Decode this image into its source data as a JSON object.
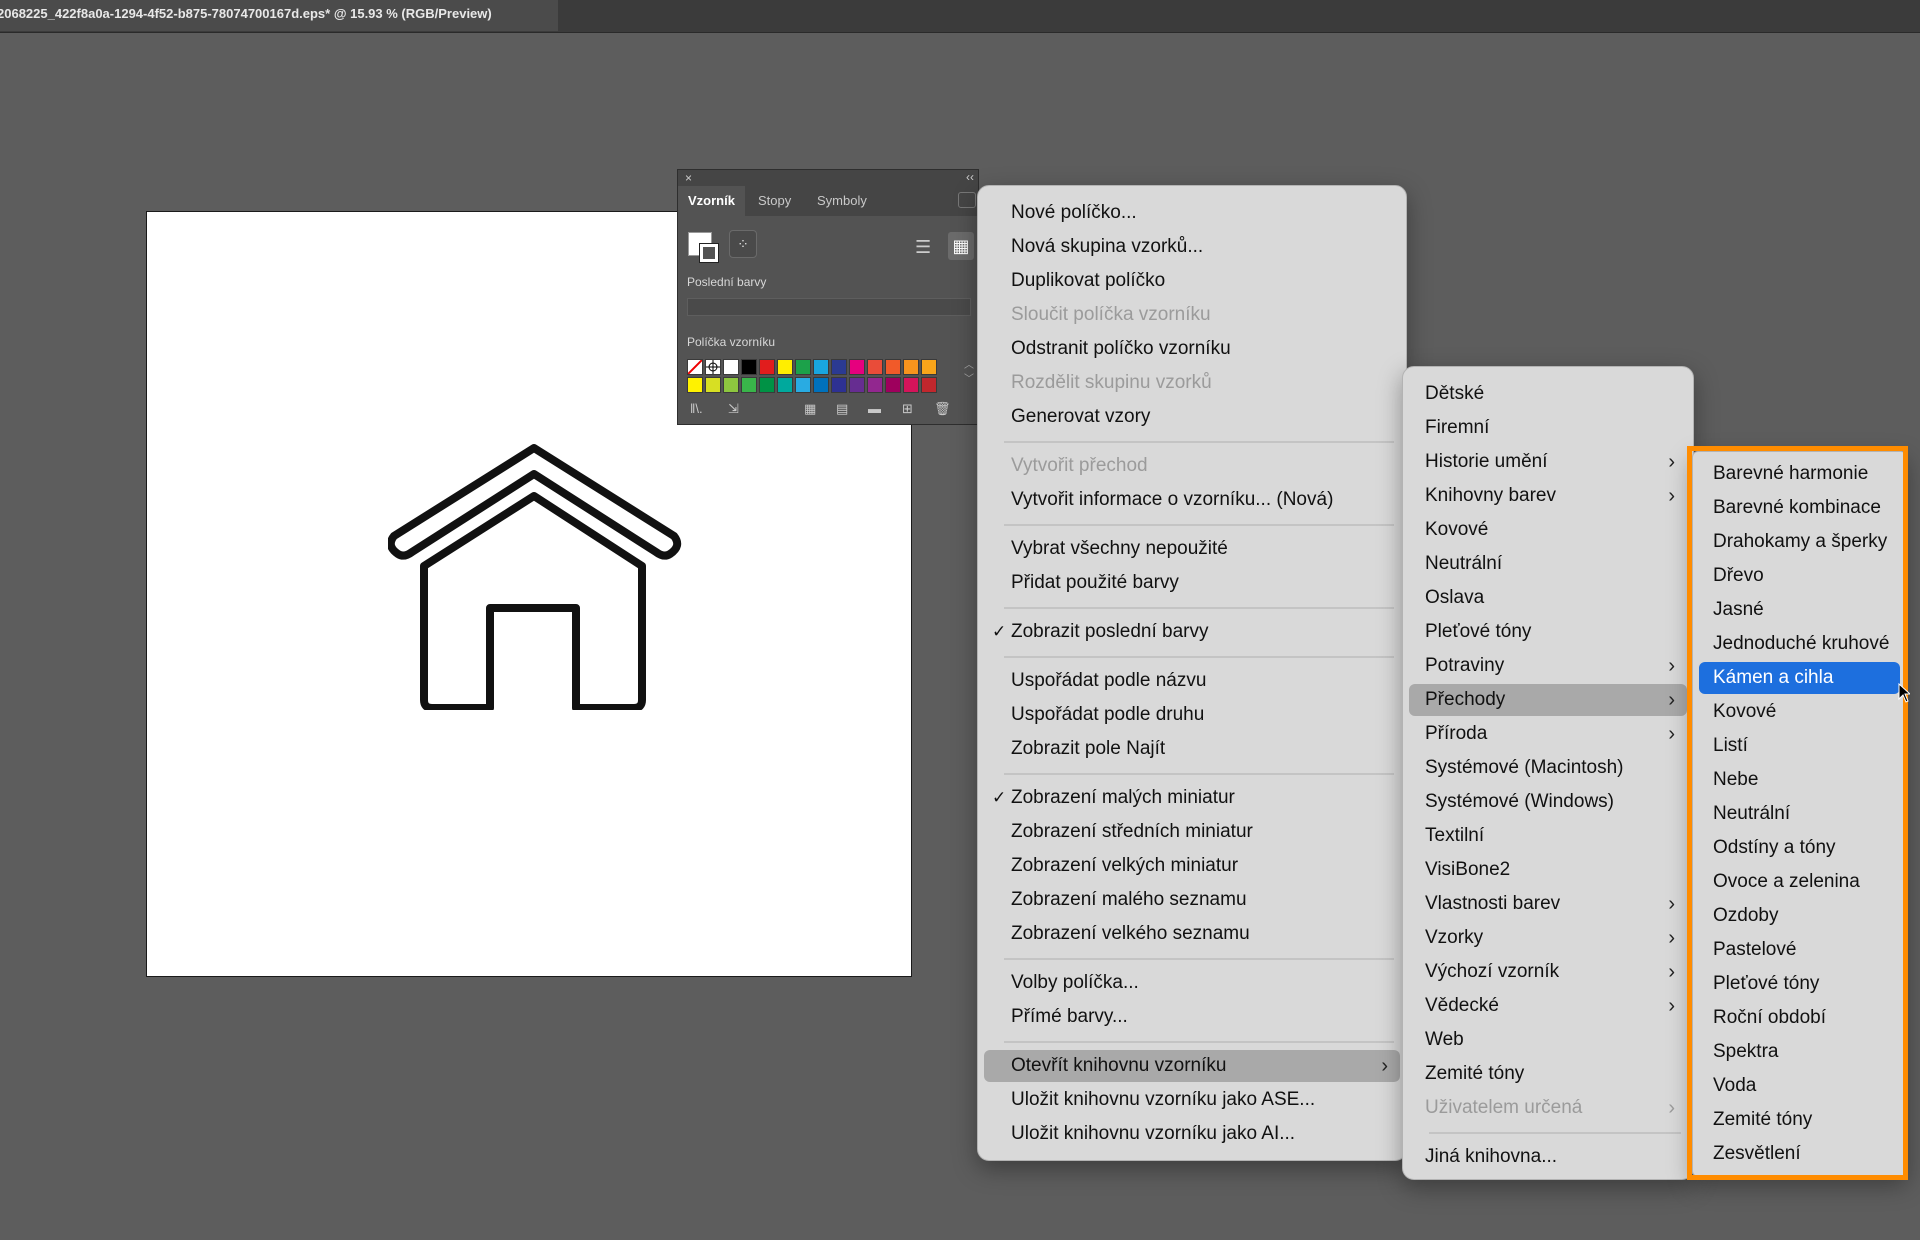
{
  "document_tab": {
    "title": "2068225_422f8a0a-1294-4f52-b875-78074700167d.eps* @ 15.93 % (RGB/Preview)"
  },
  "swatches_panel": {
    "tabs": [
      "Vzorník",
      "Stopy",
      "Symboly"
    ],
    "active_tab": "Vzorník",
    "recent_colors_label": "Poslední barvy",
    "swatches_label": "Políčka vzorníku",
    "row1_colors": [
      "#ffffff",
      "#ffffff",
      "#ffffff",
      "#000000",
      "#e11d1d",
      "#ffee00",
      "#1ca14a",
      "#19a6e0",
      "#2b3a92",
      "#e6007e",
      "#e94c39",
      "#f15a29",
      "#f7941d",
      "#f9a51a"
    ],
    "row2_colors": [
      "#fff200",
      "#d7df23",
      "#8dc63f",
      "#39b54a",
      "#009245",
      "#00a99d",
      "#29abe2",
      "#0071bc",
      "#2e3192",
      "#662d91",
      "#92278f",
      "#9e005d",
      "#d4145a",
      "#c1272d"
    ]
  },
  "main_menu": {
    "items": [
      {
        "label": "Nové políčko...",
        "disabled": false
      },
      {
        "label": "Nová skupina vzorků...",
        "disabled": false
      },
      {
        "label": "Duplikovat políčko",
        "disabled": false
      },
      {
        "label": "Sloučit políčka vzorníku",
        "disabled": true
      },
      {
        "label": "Odstranit políčko vzorníku",
        "disabled": false
      },
      {
        "label": "Rozdělit skupinu vzorků",
        "disabled": true
      },
      {
        "label": "Generovat vzory",
        "disabled": false
      },
      {
        "label": "Vytvořit přechod",
        "disabled": true
      },
      {
        "label": "Vytvořit informace o vzorníku... (Nová)",
        "disabled": false
      },
      {
        "label": "Vybrat všechny nepoužité",
        "disabled": false
      },
      {
        "label": "Přidat použité barvy",
        "disabled": false
      },
      {
        "label": "Zobrazit poslední barvy",
        "disabled": false,
        "checked": true
      },
      {
        "label": "Uspořádat podle názvu",
        "disabled": false
      },
      {
        "label": "Uspořádat podle druhu",
        "disabled": false
      },
      {
        "label": "Zobrazit pole Najít",
        "disabled": false
      },
      {
        "label": "Zobrazení malých miniatur",
        "disabled": false,
        "checked": true
      },
      {
        "label": "Zobrazení středních miniatur",
        "disabled": false
      },
      {
        "label": "Zobrazení velkých miniatur",
        "disabled": false
      },
      {
        "label": "Zobrazení malého seznamu",
        "disabled": false
      },
      {
        "label": "Zobrazení velkého seznamu",
        "disabled": false
      },
      {
        "label": "Volby políčka...",
        "disabled": false
      },
      {
        "label": "Přímé barvy...",
        "disabled": false
      },
      {
        "label": "Otevřít knihovnu vzorníku",
        "disabled": false,
        "submenu": true,
        "highlighted": true
      },
      {
        "label": "Uložit knihovnu vzorníku jako ASE...",
        "disabled": false
      },
      {
        "label": "Uložit knihovnu vzorníku jako AI...",
        "disabled": false
      }
    ],
    "check_mark": "✓"
  },
  "library_menu": {
    "items": [
      {
        "label": "Dětské"
      },
      {
        "label": "Firemní"
      },
      {
        "label": "Historie umění",
        "submenu": true
      },
      {
        "label": "Knihovny barev",
        "submenu": true
      },
      {
        "label": "Kovové"
      },
      {
        "label": "Neutrální"
      },
      {
        "label": "Oslava"
      },
      {
        "label": "Pleťové tóny"
      },
      {
        "label": "Potraviny",
        "submenu": true
      },
      {
        "label": "Přechody",
        "submenu": true,
        "highlighted": true
      },
      {
        "label": "Příroda",
        "submenu": true
      },
      {
        "label": "Systémové (Macintosh)"
      },
      {
        "label": "Systémové (Windows)"
      },
      {
        "label": "Textilní"
      },
      {
        "label": "VisiBone2"
      },
      {
        "label": "Vlastnosti barev",
        "submenu": true
      },
      {
        "label": "Vzorky",
        "submenu": true
      },
      {
        "label": "Výchozí vzorník",
        "submenu": true
      },
      {
        "label": "Vědecké",
        "submenu": true
      },
      {
        "label": "Web"
      },
      {
        "label": "Zemité tóny"
      },
      {
        "label": "Uživatelem určená",
        "submenu": true,
        "disabled": true
      },
      {
        "label": "Jiná knihovna..."
      }
    ]
  },
  "gradients_menu": {
    "items": [
      {
        "label": "Barevné harmonie"
      },
      {
        "label": "Barevné kombinace"
      },
      {
        "label": "Drahokamy a šperky"
      },
      {
        "label": "Dřevo"
      },
      {
        "label": "Jasné"
      },
      {
        "label": "Jednoduché kruhové"
      },
      {
        "label": "Kámen a cihla",
        "selected": true
      },
      {
        "label": "Kovové"
      },
      {
        "label": "Listí"
      },
      {
        "label": "Nebe"
      },
      {
        "label": "Neutrální"
      },
      {
        "label": "Odstíny a tóny"
      },
      {
        "label": "Ovoce a zelenina"
      },
      {
        "label": "Ozdoby"
      },
      {
        "label": "Pastelové"
      },
      {
        "label": "Pleťové tóny"
      },
      {
        "label": "Roční období"
      },
      {
        "label": "Spektra"
      },
      {
        "label": "Voda"
      },
      {
        "label": "Zemité tóny"
      },
      {
        "label": "Zesvětlení"
      }
    ]
  },
  "colors": {
    "highlight_accent": "#ff8c00",
    "selection_blue": "#1d6fde"
  }
}
